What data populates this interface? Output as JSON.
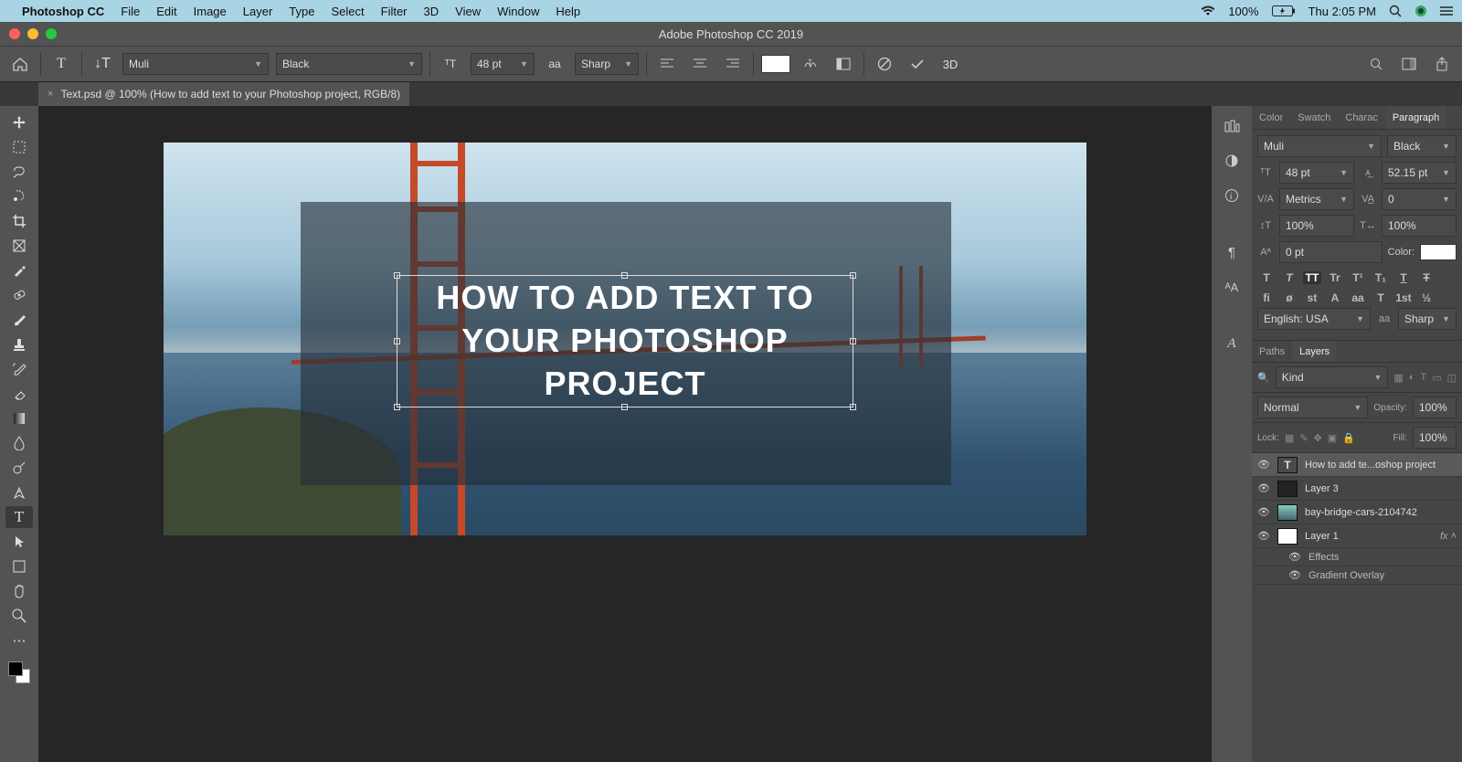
{
  "macbar": {
    "app": "Photoshop CC",
    "menus": [
      "File",
      "Edit",
      "Image",
      "Layer",
      "Type",
      "Select",
      "Filter",
      "3D",
      "View",
      "Window",
      "Help"
    ],
    "battery": "100%",
    "time": "Thu 2:05 PM"
  },
  "titlebar": {
    "title": "Adobe Photoshop CC 2019"
  },
  "optbar": {
    "font": "Muli",
    "weight": "Black",
    "size": "48 pt",
    "aa_label": "aa",
    "aa": "Sharp",
    "threed": "3D"
  },
  "doctab": {
    "label": "Text.psd @ 100% (How to add  text to your  Photoshop project, RGB/8)"
  },
  "canvas": {
    "text": "HOW TO ADD TEXT TO YOUR PHOTOSHOP PROJECT"
  },
  "charpanel": {
    "tabs": [
      "Color",
      "Swatch",
      "Charac",
      "Paragraph"
    ],
    "font": "Muli",
    "weight": "Black",
    "size": "48 pt",
    "leading": "52.15 pt",
    "kerning": "Metrics",
    "tracking": "0",
    "vscale": "100%",
    "hscale": "100%",
    "baseline": "0 pt",
    "color_label": "Color:",
    "caps": [
      "T",
      "T",
      "TT",
      "Tr",
      "T¹",
      "T₁",
      "T",
      "Ŧ"
    ],
    "opentype": [
      "fi",
      "ø",
      "st",
      "A",
      "aa",
      "T",
      "1st",
      "½"
    ],
    "lang": "English: USA",
    "aa_label": "aa",
    "aa": "Sharp"
  },
  "layerspanel": {
    "tabs": [
      "Paths",
      "Layers"
    ],
    "kind": "Kind",
    "blend": "Normal",
    "opacity_label": "Opacity:",
    "opacity": "100%",
    "lock_label": "Lock:",
    "fill_label": "Fill:",
    "fill": "100%",
    "layers": [
      {
        "name": "How to add  te...oshop project",
        "type": "text",
        "active": true
      },
      {
        "name": "Layer 3",
        "type": "dark"
      },
      {
        "name": "bay-bridge-cars-2104742",
        "type": "img"
      },
      {
        "name": "Layer 1",
        "type": "white",
        "fx": true
      }
    ],
    "effects": "Effects",
    "gradient": "Gradient Overlay"
  }
}
